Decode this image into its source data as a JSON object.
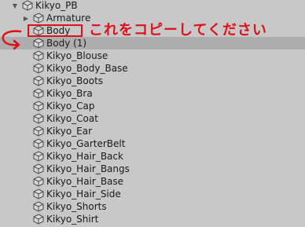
{
  "hierarchy": {
    "root": {
      "label": "Kikyo_PB",
      "expanded": true
    },
    "children": [
      {
        "label": "Armature",
        "has_children": true,
        "selected": false
      },
      {
        "label": "Body",
        "has_children": false,
        "selected": false
      },
      {
        "label": "Body (1)",
        "has_children": false,
        "selected": true
      },
      {
        "label": "Kikyo_Blouse",
        "has_children": false,
        "selected": false
      },
      {
        "label": "Kikyo_Body_Base",
        "has_children": false,
        "selected": false
      },
      {
        "label": "Kikyo_Boots",
        "has_children": false,
        "selected": false
      },
      {
        "label": "Kikyo_Bra",
        "has_children": false,
        "selected": false
      },
      {
        "label": "Kikyo_Cap",
        "has_children": false,
        "selected": false
      },
      {
        "label": "Kikyo_Coat",
        "has_children": false,
        "selected": false
      },
      {
        "label": "Kikyo_Ear",
        "has_children": false,
        "selected": false
      },
      {
        "label": "Kikyo_GarterBelt",
        "has_children": false,
        "selected": false
      },
      {
        "label": "Kikyo_Hair_Back",
        "has_children": false,
        "selected": false
      },
      {
        "label": "Kikyo_Hair_Bangs",
        "has_children": false,
        "selected": false
      },
      {
        "label": "Kikyo_Hair_Base",
        "has_children": false,
        "selected": false
      },
      {
        "label": "Kikyo_Hair_Side",
        "has_children": false,
        "selected": false
      },
      {
        "label": "Kikyo_Shorts",
        "has_children": false,
        "selected": false
      },
      {
        "label": "Kikyo_Shirt",
        "has_children": false,
        "selected": false
      }
    ]
  },
  "annotation": {
    "text": "これをコピーしてください",
    "color": "#e0101a"
  },
  "icons": {
    "expanded": "triangle-down",
    "collapsed": "triangle-right",
    "object": "cube-icon"
  }
}
